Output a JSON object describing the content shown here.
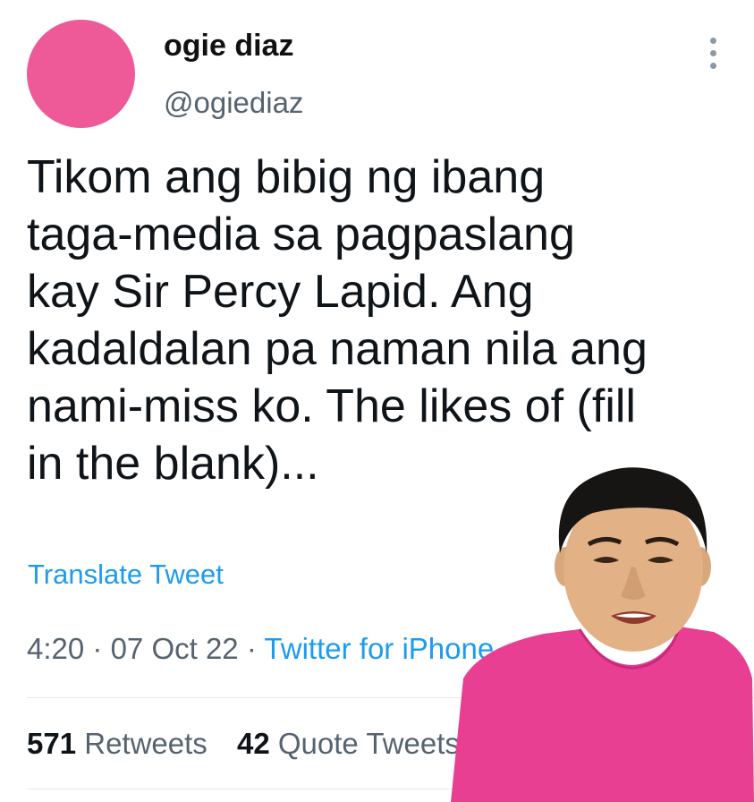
{
  "user": {
    "display_name": "ogie diaz",
    "handle": "@ogiediaz"
  },
  "tweet": {
    "text": "Tikom ang bibig ng ibang\ntaga-media sa pagpaslang\nkay Sir Percy Lapid. Ang\nkadaldalan pa naman nila ang\nnami-miss ko. The likes of (fill\nin the blank)...",
    "translate_label": "Translate Tweet",
    "time": "4:20",
    "date": "07 Oct 22",
    "separator": "·",
    "source": "Twitter for iPhone"
  },
  "stats": {
    "retweets_count": "571",
    "retweets_label": "Retweets",
    "quotes_count": "42",
    "quotes_label": "Quote Tweets"
  },
  "colors": {
    "avatar": "#ee5a97",
    "link": "#1d9bf0",
    "shirt": "#e93f93"
  },
  "icons": {
    "more": "more-vertical-icon"
  }
}
